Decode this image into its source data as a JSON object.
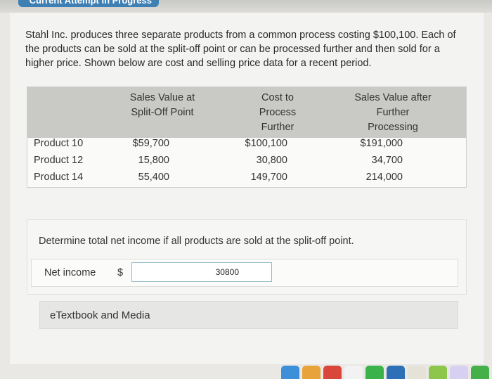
{
  "header": {
    "title": "Current Attempt in Progress"
  },
  "intro": "Stahl Inc. produces three separate products from a common process costing $100,100. Each of the products can be sold at the split-off point or can be processed further and then sold for a higher price. Shown below are cost and selling price data for a recent period.",
  "table": {
    "columns": [
      "Sales Value at Split-Off Point",
      "Cost to Process Further",
      "Sales Value after Further Processing"
    ],
    "rows": [
      {
        "product": "Product 10",
        "split_off": "$59,700",
        "cost": "$100,100",
        "further": "$191,000"
      },
      {
        "product": "Product 12",
        "split_off": "15,800",
        "cost": "30,800",
        "further": "34,700"
      },
      {
        "product": "Product 14",
        "split_off": "55,400",
        "cost": "149,700",
        "further": "214,000"
      }
    ]
  },
  "question": {
    "text": "Determine total net income if all products are sold at the split-off point.",
    "answer_label": "Net income",
    "currency": "$",
    "answer_value": "30800"
  },
  "etextbook_label": "eTextbook and Media",
  "colors": {
    "input_border": "#8fb9c9",
    "table_header": "#c9c9c6"
  }
}
